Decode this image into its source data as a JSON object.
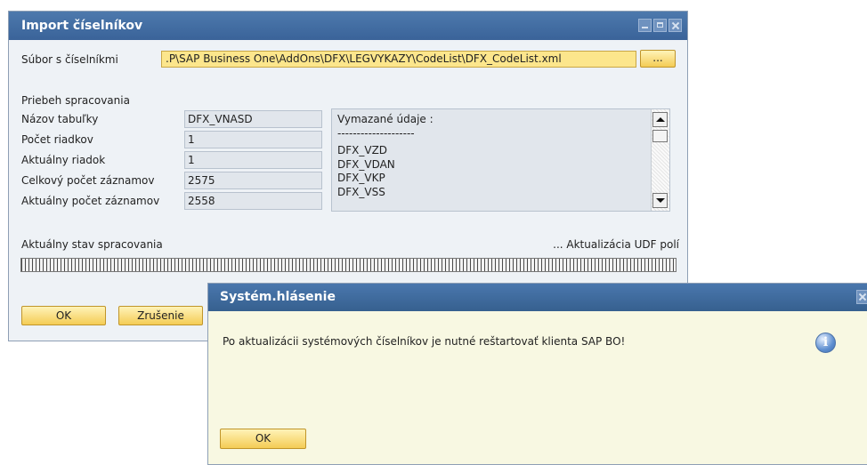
{
  "main_window": {
    "title": "Import číselníkov",
    "file_label": "Súbor s číselníkmi",
    "file_path": ".P\\SAP Business One\\AddOns\\DFX\\LEGVYKAZY\\CodeList\\DFX_CodeList.xml",
    "browse_label": "...",
    "section_title": "Priebeh spracovania",
    "fields": [
      {
        "label": "Názov tabuľky",
        "value": "DFX_VNASD"
      },
      {
        "label": "Počet riadkov",
        "value": "1"
      },
      {
        "label": "Aktuálny riadok",
        "value": "1"
      },
      {
        "label": "Celkový počet záznamov",
        "value": "2575"
      },
      {
        "label": "Aktuálny počet záznamov",
        "value": "2558"
      }
    ],
    "deleted_list": {
      "header": "Vymazané údaje :",
      "separator": "--------------------",
      "items": [
        "DFX_VZD",
        "DFX_VDAN",
        "DFX_VKP",
        "DFX_VSS"
      ]
    },
    "status_label": "Aktuálny stav spracovania",
    "status_value": "... Aktualizácia UDF polí",
    "progress": 1.0,
    "ok_label": "OK",
    "cancel_label": "Zrušenie"
  },
  "message_dialog": {
    "title": "Systém.hlásenie",
    "message": "Po aktualizácii systémových číselníkov je nutné reštartovať klienta SAP BO!",
    "ok_label": "OK",
    "icon": "info-icon"
  }
}
